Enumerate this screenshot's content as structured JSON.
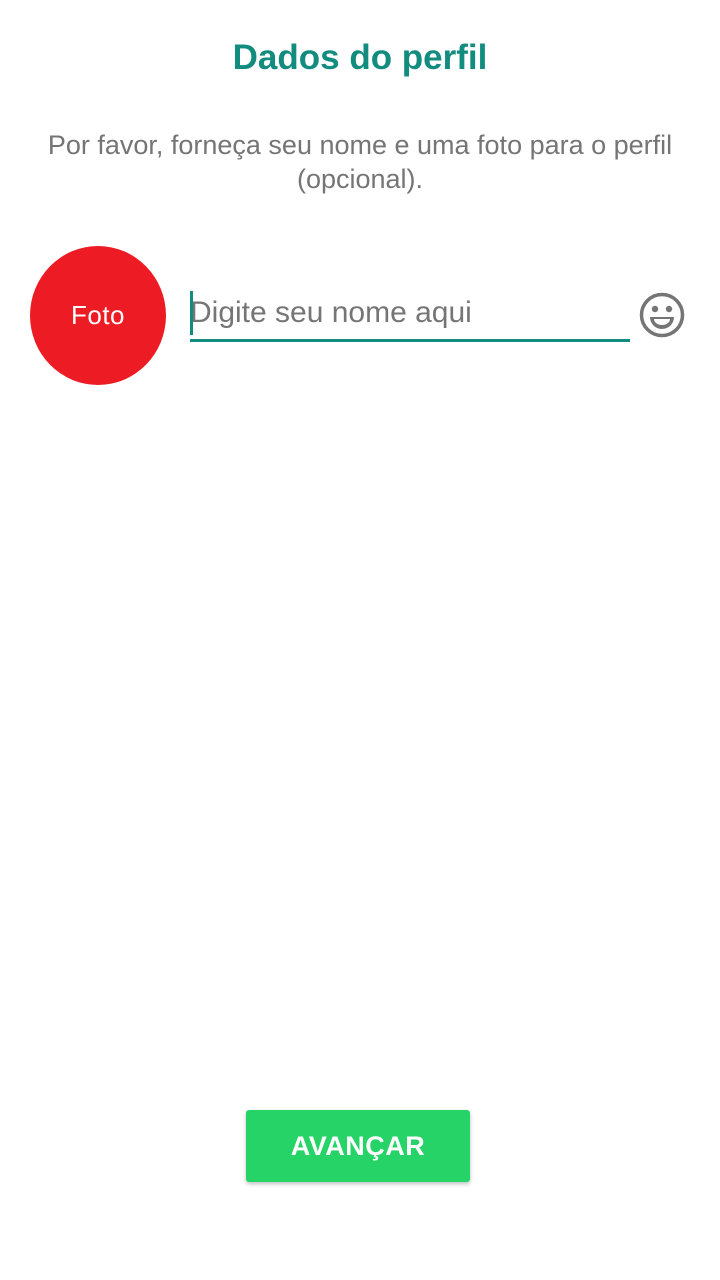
{
  "header": {
    "title": "Dados do perfil"
  },
  "instructions": {
    "text": "Por favor, forneça seu nome e uma foto para o perfil (opcional)."
  },
  "profile": {
    "photo_label": "Foto",
    "name_value": "",
    "name_placeholder": "Digite seu nome aqui",
    "emoji_icon": "smiley-face-icon"
  },
  "actions": {
    "next_label": "AVANÇAR"
  },
  "colors": {
    "accent": "#128C7E",
    "photo_background": "#ED1C24",
    "button_background": "#25D366",
    "text_secondary": "#757575"
  }
}
